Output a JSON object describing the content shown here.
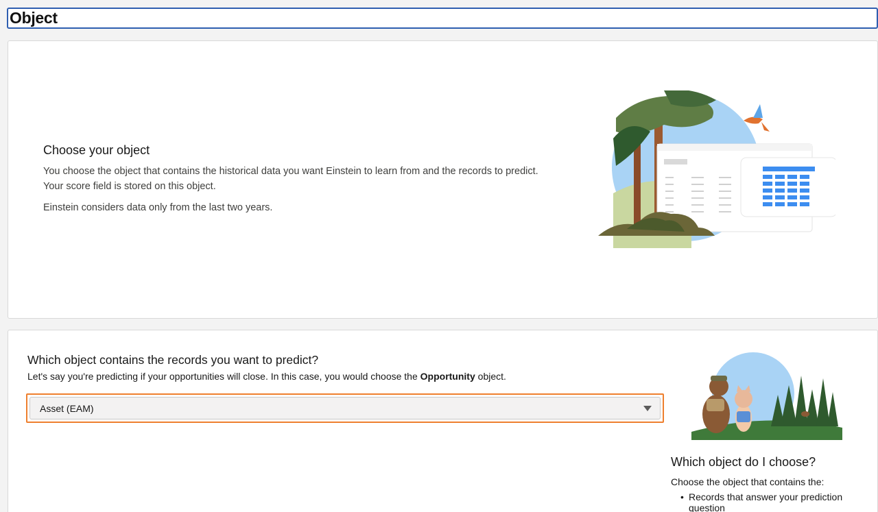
{
  "header": {
    "title": "Object"
  },
  "intro": {
    "title": "Choose your object",
    "paragraph1": "You choose the object that contains the historical data you want Einstein to learn from and the records to predict. Your score field is stored on this object.",
    "paragraph2": "Einstein considers data only from the last two years."
  },
  "question": {
    "title": "Which object contains the records you want to predict?",
    "hint_before": "Let's say you're predicting if your opportunities will close. In this case, you would choose the ",
    "hint_bold": "Opportunity",
    "hint_after": " object."
  },
  "object_select": {
    "value": "Asset (EAM)",
    "accent_color": "#ee7f2d"
  },
  "help": {
    "title": "Which object do I choose?",
    "intro": "Choose the object that contains the:",
    "items": [
      "Records that answer your prediction question"
    ]
  },
  "icons": {
    "select_arrow": "chevron-down-icon",
    "intro_illustration": "dashboard-landscape-illustration",
    "side_illustration": "mascots-forest-illustration"
  },
  "colors": {
    "header_border": "#2e5eb0",
    "sky": "#a9d3f5",
    "tree_green": "#2f5a2e",
    "table_blue": "#3c8df0"
  }
}
